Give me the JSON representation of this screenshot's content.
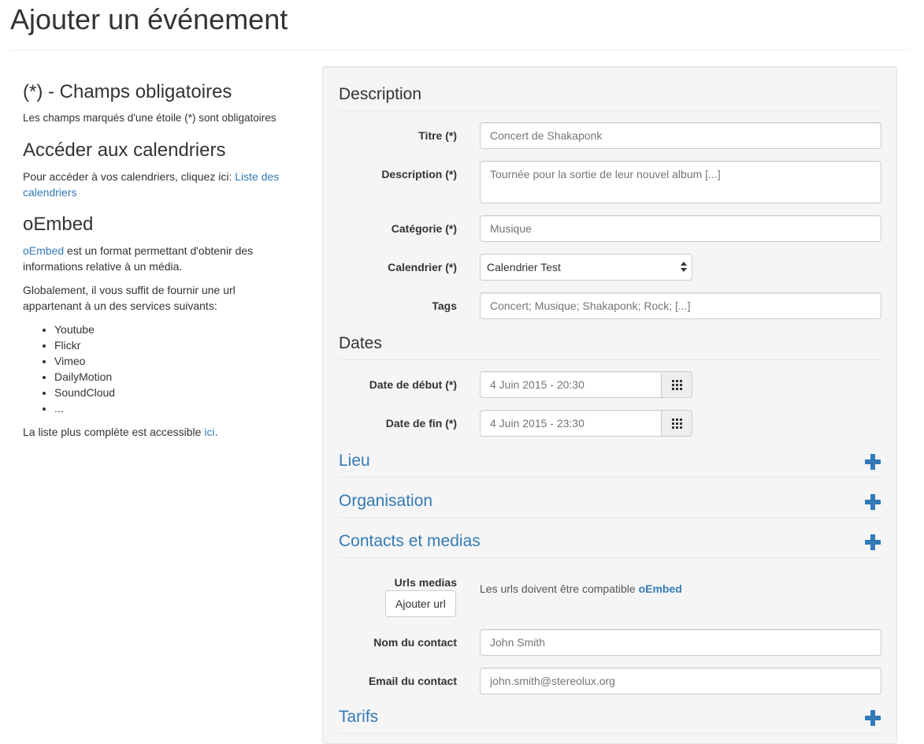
{
  "page": {
    "title": "Ajouter un événement"
  },
  "sidebar": {
    "required_heading": "(*) - Champs obligatoires",
    "required_text": "Les champs marqués d'une étoile (*) sont obligatoires",
    "calendars_heading": "Accéder aux calendriers",
    "calendars_text": "Pour accéder à vos calendriers, cliquez ici: ",
    "calendars_link": "Liste des calendriers",
    "oembed_heading": "oEmbed",
    "oembed_link": "oEmbed",
    "oembed_text": " est un format permettant d'obtenir des informations relative à un média.",
    "services_intro": "Globalement, il vous suffit de fournir une url appartenant à un des services suivants:",
    "services": [
      "Youtube",
      "Flickr",
      "Vimeo",
      "DailyMotion",
      "SoundCloud",
      "..."
    ],
    "list_text": "La liste plus complète est accessible ",
    "list_link": "ici",
    "list_end": "."
  },
  "form": {
    "description_legend": "Description",
    "title_label": "Titre (*)",
    "title_placeholder": "Concert de Shakaponk",
    "description_label": "Description (*)",
    "description_placeholder": "Tournée pour la sortie de leur nouvel album [...]",
    "category_label": "Catégorie (*)",
    "category_placeholder": "Musique",
    "calendar_label": "Calendrier (*)",
    "calendar_value": "Calendrier Test",
    "tags_label": "Tags",
    "tags_placeholder": "Concert; Musique; Shakaponk; Rock; [...]",
    "dates_legend": "Dates",
    "start_label": "Date de début (*)",
    "start_placeholder": "4 Juin 2015 - 20:30",
    "end_label": "Date de fin (*)",
    "end_placeholder": "4 Juin 2015 - 23:30",
    "lieu_legend": "Lieu",
    "organisation_legend": "Organisation",
    "contacts_legend": "Contacts et medias",
    "urls_label": "Urls medias",
    "add_url_button": "Ajouter url",
    "urls_hint": "Les urls doivent être compatible ",
    "urls_hint_link": "oEmbed",
    "contact_name_label": "Nom du contact",
    "contact_name_placeholder": "John Smith",
    "contact_email_label": "Email du contact",
    "contact_email_placeholder": "john.smith@stereolux.org",
    "tarifs_legend": "Tarifs"
  },
  "icons": {
    "expand": "plus-icon",
    "calendar": "grid-icon"
  },
  "colors": {
    "link": "#337ab7",
    "panel_bg": "#f5f5f5"
  }
}
